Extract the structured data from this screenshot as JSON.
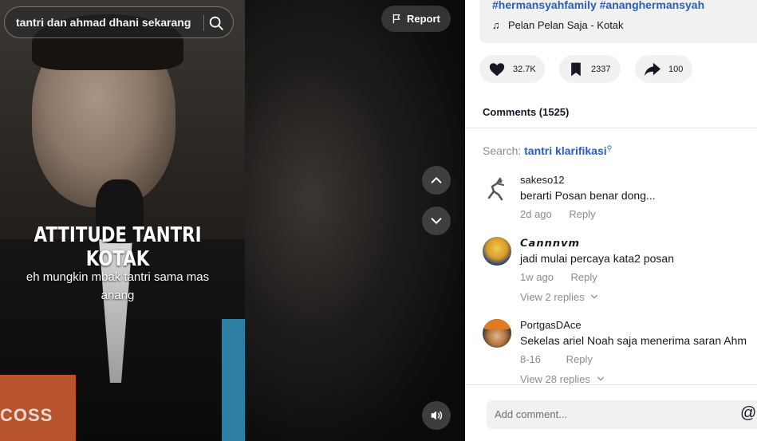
{
  "video": {
    "search_query": "tantri dan ahmad dhani sekarang",
    "report_label": "Report",
    "overlay_title": "ATTITUDE TANTRI KOTAK",
    "overlay_subtitle": "eh mungkin mbak tantri sama mas anang",
    "banner_text": "COSS"
  },
  "description": {
    "hashtags": "#hermansyahfamily #ananghermansyah",
    "music": "Pelan Pelan Saja - Kotak"
  },
  "actions": {
    "likes": "32.7K",
    "saves": "2337",
    "shares": "100"
  },
  "comments_header": "Comments (1525)",
  "search_hint": {
    "prefix": "Search:",
    "query": "tantri klarifikasi"
  },
  "comments": [
    {
      "user": "sakeso12",
      "text": "berarti Posan benar dong...",
      "date": "2d ago",
      "reply": "Reply",
      "replies": ""
    },
    {
      "user": "𝘾𝙖𝙣𝙣𝙣𝙫𝙢",
      "text": "jadi mulai percaya kata2 posan",
      "date": "1w ago",
      "reply": "Reply",
      "replies": "View 2 replies"
    },
    {
      "user": "PortgasDAce",
      "text": "Sekelas ariel Noah saja menerima saran Ahm",
      "date": "8-16",
      "reply": "Reply",
      "replies": "View 28 replies"
    }
  ],
  "add_comment_placeholder": "Add comment...",
  "icons": {
    "search": "search-icon",
    "report": "flag-icon",
    "up": "chevron-up-icon",
    "down": "chevron-down-icon",
    "volume": "volume-icon",
    "music": "music-note-icon",
    "like": "heart-icon",
    "save": "bookmark-icon",
    "share": "share-icon",
    "mention": "at-icon"
  },
  "colors": {
    "link": "#2b5db9",
    "muted": "#8a8b91",
    "chip_bg": "#f1f1f2"
  }
}
